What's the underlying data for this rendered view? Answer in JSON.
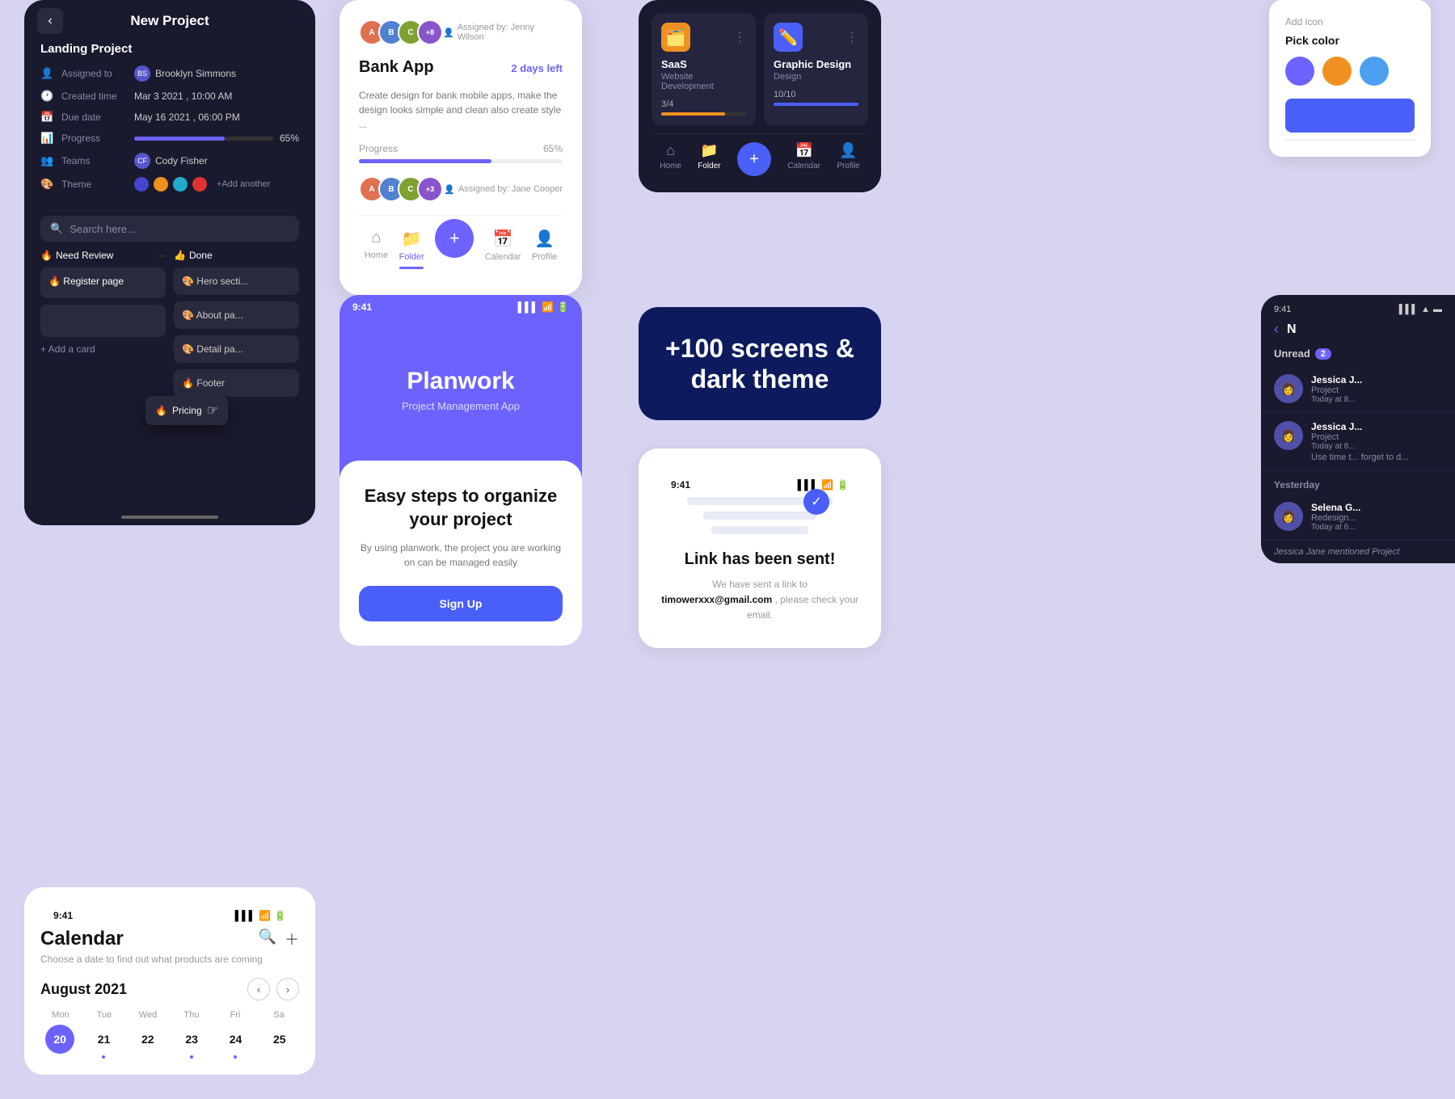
{
  "app": {
    "background": "#d6d4f0"
  },
  "card_new_project": {
    "title": "New Project",
    "project_name": "Landing Project",
    "back_label": "‹",
    "assigned_to_label": "Assigned to",
    "assigned_to_value": "Brooklyn Simmons",
    "created_time_label": "Created time",
    "created_time_value": "Mar 3 2021 , 10:00 AM",
    "due_date_label": "Due date",
    "due_date_value": "May 16 2021 , 06:00 PM",
    "progress_label": "Progress",
    "progress_value": "65%",
    "progress_pct": 65,
    "teams_label": "Teams",
    "teams_value": "Cody Fisher",
    "theme_label": "Theme",
    "add_another": "+Add another",
    "search_placeholder": "Search here...",
    "col1_title": "Need Review",
    "col1_emoji": "🔥",
    "col1_card1": "Register page",
    "col1_card1_emoji": "🔥",
    "col2_title": "Done",
    "col2_emoji": "👍",
    "col2_card1": "Hero secti...",
    "col2_card1_emoji": "🎨",
    "col2_card2": "About pa...",
    "col2_card2_emoji": "🎨",
    "col2_card3": "Detail pa...",
    "col2_card3_emoji": "🎨",
    "add_card": "+ Add a card",
    "dragging_card": "Pricing",
    "dragging_emoji": "🔥"
  },
  "card_bank": {
    "assigned_by": "Assigned by: Jenny Wilson",
    "app_name": "Bank App",
    "days_left": "2 days left",
    "description": "Create design for bank mobile apps, make the design looks simple and clean also create style ...",
    "progress_label": "Progress",
    "progress_value": "65%",
    "assigned_by2": "Assigned by: Jane Cooper",
    "nav_home": "Home",
    "nav_folder": "Folder",
    "nav_calendar": "Calendar",
    "nav_profile": "Profile"
  },
  "card_dark_projects": {
    "proj1_name": "SaaS",
    "proj1_sub": "Website Development",
    "proj1_progress": "3/4",
    "proj1_pct": 75,
    "proj2_name": "Graphic Design",
    "proj2_sub": "Design",
    "proj2_progress": "10/10",
    "proj2_pct": 100,
    "nav_home": "Home",
    "nav_folder": "Folder",
    "nav_calendar": "Calendar",
    "nav_profile": "Profile"
  },
  "card_pick_color": {
    "add_icon_label": "Add icon",
    "title": "Pick color"
  },
  "card_100screens": {
    "text_line1": "+100 screens &",
    "text_line2": "dark theme"
  },
  "card_calendar": {
    "status_time": "9:41",
    "title": "Calendar",
    "subtitle": "Choose a date to find out what products are coming",
    "month": "August 2021",
    "days_header": [
      "Mon",
      "Tue",
      "Wed",
      "Thu",
      "Fri",
      "Sa"
    ],
    "days": [
      "20",
      "21",
      "22",
      "23",
      "24",
      "25"
    ],
    "today": "20"
  },
  "card_planwork": {
    "status_time": "9:41",
    "app_title": "Planwork",
    "app_subtitle": "Project Management App",
    "headline": "Easy steps to organize your project",
    "description": "By using planwork, the project you are working on can be managed easily",
    "btn_label": "Sign Up"
  },
  "card_link_sent": {
    "status_time": "9:41",
    "title": "Link has been sent!",
    "desc_part1": "We have sent a link to",
    "email": "timowerxxx@gmail.com",
    "desc_part2": ", please check your email."
  },
  "card_messages": {
    "status_time": "9:41",
    "title_abbr": "N",
    "unread_label": "Unread",
    "unread_count": "2",
    "msg1_name": "Jessica J...",
    "msg1_sub": "Project",
    "msg1_time": "Today at 8...",
    "msg2_name": "Jessica J...",
    "msg2_sub": "Project",
    "msg2_time": "Today at 8...",
    "msg2_preview": "Use time t... forget to d...",
    "yesterday_label": "Yesterday",
    "msg3_name": "Selena G...",
    "msg3_sub": "Redesign...",
    "msg3_time": "Today at 6...",
    "footer_note": "Jessica Jane mentioned Project"
  }
}
